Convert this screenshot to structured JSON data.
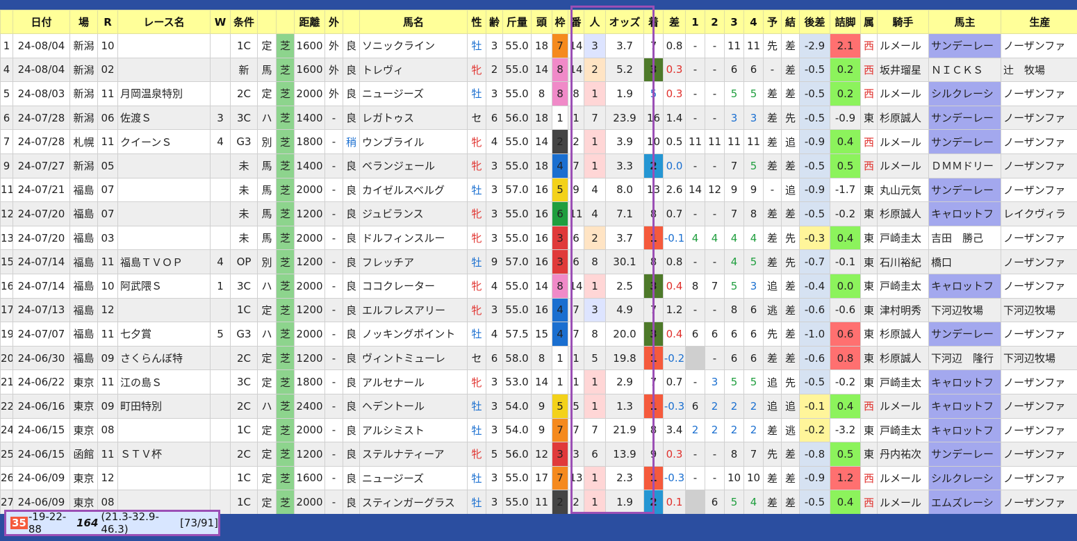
{
  "headers": [
    "",
    "日付",
    "場",
    "R",
    "レース名",
    "W",
    "条件",
    "",
    "",
    "距離",
    "外",
    "",
    "馬名",
    "性",
    "齢",
    "斤量",
    "頭",
    "枠",
    "番",
    "人",
    "オッズ",
    "着",
    "差",
    "1",
    "2",
    "3",
    "4",
    "予",
    "結",
    "後差",
    "詰脚",
    "属",
    "騎手",
    "馬主",
    "生産"
  ],
  "rows": [
    {
      "n": "1",
      "date": "24-08/04",
      "place": "新潟",
      "r": "10",
      "race": "",
      "w": "",
      "cls": "1C",
      "cond": "定",
      "surf": "芝",
      "dist": "1600",
      "out": "外",
      "going": "良",
      "horse": "ソニックライン",
      "sex": "牡",
      "age": "3",
      "wt": "55.0",
      "heads": "18",
      "waku": "7",
      "num": "14",
      "pop": "3",
      "odds": "3.7",
      "rank": "7",
      "diff": "0.8",
      "c1": "-",
      "c2": "-",
      "c3": "11",
      "c4": "11",
      "pred": "先",
      "res": "差",
      "ato": "-2.9",
      "tsume": "2.1",
      "zoku": "西",
      "jockey": "ルメール",
      "owner": "サンデーレー",
      "breeder": "ノーザンファ"
    },
    {
      "n": "4",
      "date": "24-08/04",
      "place": "新潟",
      "r": "02",
      "race": "",
      "w": "",
      "cls": "新",
      "cond": "馬",
      "surf": "芝",
      "dist": "1600",
      "out": "外",
      "going": "良",
      "horse": "トレヴィ",
      "sex": "牝",
      "age": "2",
      "wt": "55.0",
      "heads": "14",
      "waku": "8",
      "num": "14",
      "pop": "2",
      "odds": "5.2",
      "rank": "3",
      "diff": "0.3",
      "c1": "-",
      "c2": "-",
      "c3": "6",
      "c4": "6",
      "pred": "-",
      "res": "差",
      "ato": "-0.5",
      "tsume": "0.2",
      "zoku": "西",
      "jockey": "坂井瑠星",
      "owner": "ＮＩＣＫＳ",
      "breeder": "辻　牧場"
    },
    {
      "n": "5",
      "date": "24-08/03",
      "place": "新潟",
      "r": "11",
      "race": "月岡温泉特別",
      "w": "",
      "cls": "2C",
      "cond": "定",
      "surf": "芝",
      "dist": "2000",
      "out": "外",
      "going": "良",
      "horse": "ニュージーズ",
      "sex": "牡",
      "age": "3",
      "wt": "55.0",
      "heads": "8",
      "waku": "8",
      "num": "8",
      "pop": "1",
      "odds": "1.9",
      "rank": "5",
      "diff": "0.3",
      "c1": "-",
      "c2": "-",
      "c3": "5",
      "c4": "5",
      "pred": "差",
      "res": "差",
      "ato": "-0.5",
      "tsume": "0.2",
      "zoku": "西",
      "jockey": "ルメール",
      "owner": "シルクレーシ",
      "breeder": "ノーザンファ"
    },
    {
      "n": "6",
      "date": "24-07/28",
      "place": "新潟",
      "r": "06",
      "race": "佐渡Ｓ",
      "w": "3",
      "cls": "3C",
      "cond": "ハ",
      "surf": "芝",
      "dist": "1400",
      "out": "-",
      "going": "良",
      "horse": "レガトゥス",
      "sex": "セ",
      "age": "6",
      "wt": "56.0",
      "heads": "18",
      "waku": "1",
      "num": "1",
      "pop": "7",
      "odds": "23.9",
      "rank": "16",
      "diff": "1.4",
      "c1": "-",
      "c2": "-",
      "c3": "3",
      "c4": "3",
      "pred": "差",
      "res": "先",
      "ato": "-0.5",
      "tsume": "-0.9",
      "zoku": "東",
      "jockey": "杉原誠人",
      "owner": "サンデーレー",
      "breeder": "ノーザンファ"
    },
    {
      "n": "7",
      "date": "24-07/28",
      "place": "札幌",
      "r": "11",
      "race": "クイーンＳ",
      "w": "4",
      "cls": "G3",
      "cond": "別",
      "surf": "芝",
      "dist": "1800",
      "out": "-",
      "going": "稍",
      "horse": "ウンブライル",
      "sex": "牝",
      "age": "4",
      "wt": "55.0",
      "heads": "14",
      "waku": "2",
      "num": "2",
      "pop": "1",
      "odds": "3.9",
      "rank": "10",
      "diff": "0.5",
      "c1": "11",
      "c2": "11",
      "c3": "11",
      "c4": "11",
      "pred": "差",
      "res": "追",
      "ato": "-0.9",
      "tsume": "0.4",
      "zoku": "西",
      "jockey": "ルメール",
      "owner": "サンデーレー",
      "breeder": "ノーザンファ"
    },
    {
      "n": "9",
      "date": "24-07/27",
      "place": "新潟",
      "r": "05",
      "race": "",
      "w": "",
      "cls": "未",
      "cond": "馬",
      "surf": "芝",
      "dist": "1400",
      "out": "-",
      "going": "良",
      "horse": "ベランジェール",
      "sex": "牝",
      "age": "3",
      "wt": "55.0",
      "heads": "18",
      "waku": "4",
      "num": "7",
      "pop": "1",
      "odds": "3.3",
      "rank": "2",
      "diff": "0.0",
      "c1": "-",
      "c2": "-",
      "c3": "7",
      "c4": "5",
      "pred": "差",
      "res": "差",
      "ato": "-0.5",
      "tsume": "0.5",
      "zoku": "西",
      "jockey": "ルメール",
      "owner": "ＤＭＭドリー",
      "breeder": "ノーザンファ"
    },
    {
      "n": "11",
      "date": "24-07/21",
      "place": "福島",
      "r": "07",
      "race": "",
      "w": "",
      "cls": "未",
      "cond": "馬",
      "surf": "芝",
      "dist": "2000",
      "out": "-",
      "going": "良",
      "horse": "カイゼルスベルグ",
      "sex": "牡",
      "age": "3",
      "wt": "57.0",
      "heads": "16",
      "waku": "5",
      "num": "9",
      "pop": "4",
      "odds": "8.0",
      "rank": "13",
      "diff": "2.6",
      "c1": "14",
      "c2": "12",
      "c3": "9",
      "c4": "9",
      "pred": "-",
      "res": "追",
      "ato": "-0.9",
      "tsume": "-1.7",
      "zoku": "東",
      "jockey": "丸山元気",
      "owner": "サンデーレー",
      "breeder": "ノーザンファ"
    },
    {
      "n": "12",
      "date": "24-07/20",
      "place": "福島",
      "r": "07",
      "race": "",
      "w": "",
      "cls": "未",
      "cond": "馬",
      "surf": "芝",
      "dist": "1200",
      "out": "-",
      "going": "良",
      "horse": "ジュビランス",
      "sex": "牝",
      "age": "3",
      "wt": "55.0",
      "heads": "16",
      "waku": "6",
      "num": "11",
      "pop": "4",
      "odds": "7.1",
      "rank": "8",
      "diff": "0.7",
      "c1": "-",
      "c2": "-",
      "c3": "7",
      "c4": "8",
      "pred": "差",
      "res": "差",
      "ato": "-0.5",
      "tsume": "-0.2",
      "zoku": "東",
      "jockey": "杉原誠人",
      "owner": "キャロットフ",
      "breeder": "レイクヴィラ"
    },
    {
      "n": "13",
      "date": "24-07/20",
      "place": "福島",
      "r": "03",
      "race": "",
      "w": "",
      "cls": "未",
      "cond": "馬",
      "surf": "芝",
      "dist": "2000",
      "out": "-",
      "going": "良",
      "horse": "ドルフィンスルー",
      "sex": "牝",
      "age": "3",
      "wt": "55.0",
      "heads": "16",
      "waku": "3",
      "num": "6",
      "pop": "2",
      "odds": "3.7",
      "rank": "1",
      "diff": "-0.1",
      "c1": "4",
      "c2": "4",
      "c3": "4",
      "c4": "4",
      "pred": "差",
      "res": "先",
      "ato": "-0.3",
      "tsume": "0.4",
      "zoku": "東",
      "jockey": "戸崎圭太",
      "owner": "吉田　勝己",
      "breeder": "ノーザンファ"
    },
    {
      "n": "15",
      "date": "24-07/14",
      "place": "福島",
      "r": "11",
      "race": "福島ＴＶＯＰ",
      "w": "4",
      "cls": "OP",
      "cond": "別",
      "surf": "芝",
      "dist": "1200",
      "out": "-",
      "going": "良",
      "horse": "フレッチア",
      "sex": "牡",
      "age": "9",
      "wt": "57.0",
      "heads": "16",
      "waku": "3",
      "num": "6",
      "pop": "8",
      "odds": "30.1",
      "rank": "8",
      "diff": "0.8",
      "c1": "-",
      "c2": "-",
      "c3": "4",
      "c4": "5",
      "pred": "差",
      "res": "先",
      "ato": "-0.7",
      "tsume": "-0.1",
      "zoku": "東",
      "jockey": "石川裕紀",
      "owner": "橋口",
      "breeder": "ノーザンファ"
    },
    {
      "n": "16",
      "date": "24-07/14",
      "place": "福島",
      "r": "10",
      "race": "阿武隈Ｓ",
      "w": "1",
      "cls": "3C",
      "cond": "ハ",
      "surf": "芝",
      "dist": "2000",
      "out": "-",
      "going": "良",
      "horse": "ココクレーター",
      "sex": "牝",
      "age": "4",
      "wt": "55.0",
      "heads": "14",
      "waku": "8",
      "num": "14",
      "pop": "1",
      "odds": "2.5",
      "rank": "3",
      "diff": "0.4",
      "c1": "8",
      "c2": "7",
      "c3": "5",
      "c4": "3",
      "pred": "追",
      "res": "差",
      "ato": "-0.4",
      "tsume": "0.0",
      "zoku": "東",
      "jockey": "戸崎圭太",
      "owner": "キャロットフ",
      "breeder": "ノーザンファ"
    },
    {
      "n": "17",
      "date": "24-07/13",
      "place": "福島",
      "r": "12",
      "race": "",
      "w": "",
      "cls": "1C",
      "cond": "定",
      "surf": "芝",
      "dist": "1200",
      "out": "-",
      "going": "良",
      "horse": "エルフレスアリー",
      "sex": "牝",
      "age": "3",
      "wt": "55.0",
      "heads": "16",
      "waku": "4",
      "num": "7",
      "pop": "3",
      "odds": "4.9",
      "rank": "7",
      "diff": "1.2",
      "c1": "-",
      "c2": "-",
      "c3": "8",
      "c4": "6",
      "pred": "逃",
      "res": "差",
      "ato": "-0.6",
      "tsume": "-0.6",
      "zoku": "東",
      "jockey": "津村明秀",
      "owner": "下河辺牧場",
      "breeder": "下河辺牧場"
    },
    {
      "n": "19",
      "date": "24-07/07",
      "place": "福島",
      "r": "11",
      "race": "七夕賞",
      "w": "5",
      "cls": "G3",
      "cond": "ハ",
      "surf": "芝",
      "dist": "2000",
      "out": "-",
      "going": "良",
      "horse": "ノッキングポイント",
      "sex": "牡",
      "age": "4",
      "wt": "57.5",
      "heads": "15",
      "waku": "4",
      "num": "7",
      "pop": "8",
      "odds": "20.0",
      "rank": "3",
      "diff": "0.4",
      "c1": "6",
      "c2": "6",
      "c3": "6",
      "c4": "6",
      "pred": "先",
      "res": "差",
      "ato": "-1.0",
      "tsume": "0.6",
      "zoku": "東",
      "jockey": "杉原誠人",
      "owner": "サンデーレー",
      "breeder": "ノーザンファ"
    },
    {
      "n": "20",
      "date": "24-06/30",
      "place": "福島",
      "r": "09",
      "race": "さくらんぼ特",
      "w": "",
      "cls": "2C",
      "cond": "定",
      "surf": "芝",
      "dist": "1200",
      "out": "-",
      "going": "良",
      "horse": "ヴィントミューレ",
      "sex": "セ",
      "age": "6",
      "wt": "58.0",
      "heads": "8",
      "waku": "1",
      "num": "1",
      "pop": "5",
      "odds": "19.8",
      "rank": "1",
      "diff": "-0.2",
      "c1": "",
      "c2": "-",
      "c3": "6",
      "c4": "6",
      "pred": "差",
      "res": "差",
      "ato": "-0.6",
      "tsume": "0.8",
      "zoku": "東",
      "jockey": "杉原誠人",
      "owner": "下河辺　隆行",
      "breeder": "下河辺牧場"
    },
    {
      "n": "21",
      "date": "24-06/22",
      "place": "東京",
      "r": "11",
      "race": "江の島Ｓ",
      "w": "",
      "cls": "3C",
      "cond": "定",
      "surf": "芝",
      "dist": "1800",
      "out": "-",
      "going": "良",
      "horse": "アルセナール",
      "sex": "牝",
      "age": "3",
      "wt": "53.0",
      "heads": "14",
      "waku": "1",
      "num": "1",
      "pop": "1",
      "odds": "2.9",
      "rank": "7",
      "diff": "0.7",
      "c1": "-",
      "c2": "3",
      "c3": "5",
      "c4": "5",
      "pred": "追",
      "res": "先",
      "ato": "-0.5",
      "tsume": "-0.2",
      "zoku": "東",
      "jockey": "戸崎圭太",
      "owner": "キャロットフ",
      "breeder": "ノーザンファ"
    },
    {
      "n": "22",
      "date": "24-06/16",
      "place": "東京",
      "r": "09",
      "race": "町田特別",
      "w": "",
      "cls": "2C",
      "cond": "ハ",
      "surf": "芝",
      "dist": "2400",
      "out": "-",
      "going": "良",
      "horse": "ヘデントール",
      "sex": "牡",
      "age": "3",
      "wt": "54.0",
      "heads": "9",
      "waku": "5",
      "num": "5",
      "pop": "1",
      "odds": "1.3",
      "rank": "1",
      "diff": "-0.3",
      "c1": "6",
      "c2": "2",
      "c3": "2",
      "c4": "2",
      "pred": "追",
      "res": "追",
      "ato": "-0.1",
      "tsume": "0.4",
      "zoku": "西",
      "jockey": "ルメール",
      "owner": "キャロットフ",
      "breeder": "ノーザンファ"
    },
    {
      "n": "24",
      "date": "24-06/15",
      "place": "東京",
      "r": "08",
      "race": "",
      "w": "",
      "cls": "1C",
      "cond": "定",
      "surf": "芝",
      "dist": "2000",
      "out": "-",
      "going": "良",
      "horse": "アルシミスト",
      "sex": "牡",
      "age": "3",
      "wt": "54.0",
      "heads": "9",
      "waku": "7",
      "num": "7",
      "pop": "7",
      "odds": "21.9",
      "rank": "8",
      "diff": "3.4",
      "c1": "2",
      "c2": "2",
      "c3": "2",
      "c4": "2",
      "pred": "差",
      "res": "逃",
      "ato": "-0.2",
      "tsume": "-3.2",
      "zoku": "東",
      "jockey": "戸崎圭太",
      "owner": "キャロットフ",
      "breeder": "ノーザンファ"
    },
    {
      "n": "25",
      "date": "24-06/15",
      "place": "函館",
      "r": "11",
      "race": "ＳＴＶ杯",
      "w": "",
      "cls": "2C",
      "cond": "定",
      "surf": "芝",
      "dist": "1200",
      "out": "-",
      "going": "良",
      "horse": "ステルナティーア",
      "sex": "牝",
      "age": "5",
      "wt": "56.0",
      "heads": "12",
      "waku": "3",
      "num": "3",
      "pop": "6",
      "odds": "13.9",
      "rank": "9",
      "diff": "0.3",
      "c1": "-",
      "c2": "-",
      "c3": "8",
      "c4": "7",
      "pred": "先",
      "res": "差",
      "ato": "-0.8",
      "tsume": "0.5",
      "zoku": "東",
      "jockey": "丹内祐次",
      "owner": "サンデーレー",
      "breeder": "ノーザンファ"
    },
    {
      "n": "26",
      "date": "24-06/09",
      "place": "東京",
      "r": "12",
      "race": "",
      "w": "",
      "cls": "1C",
      "cond": "定",
      "surf": "芝",
      "dist": "1600",
      "out": "-",
      "going": "良",
      "horse": "ニュージーズ",
      "sex": "牡",
      "age": "3",
      "wt": "55.0",
      "heads": "17",
      "waku": "7",
      "num": "13",
      "pop": "1",
      "odds": "2.3",
      "rank": "1",
      "diff": "-0.3",
      "c1": "-",
      "c2": "-",
      "c3": "10",
      "c4": "10",
      "pred": "差",
      "res": "差",
      "ato": "-0.9",
      "tsume": "1.2",
      "zoku": "西",
      "jockey": "ルメール",
      "owner": "シルクレーシ",
      "breeder": "ノーザンファ"
    },
    {
      "n": "27",
      "date": "24-06/09",
      "place": "東京",
      "r": "08",
      "race": "",
      "w": "",
      "cls": "1C",
      "cond": "定",
      "surf": "芝",
      "dist": "2000",
      "out": "-",
      "going": "良",
      "horse": "スティンガーグラス",
      "sex": "牡",
      "age": "3",
      "wt": "55.0",
      "heads": "11",
      "waku": "2",
      "num": "2",
      "pop": "1",
      "odds": "1.9",
      "rank": "2",
      "diff": "0.1",
      "c1": "",
      "c2": "6",
      "c3": "5",
      "c4": "4",
      "pred": "差",
      "res": "差",
      "ato": "-0.5",
      "tsume": "0.4",
      "zoku": "西",
      "jockey": "ルメール",
      "owner": "エムズレーシ",
      "breeder": "ノーザンファ"
    }
  ],
  "footer": {
    "badge": "35",
    "rest": "-19-22-88",
    "bold": "164",
    "paren": "(21.3-32.9-46.3)",
    "bracket": "[73/91]"
  }
}
